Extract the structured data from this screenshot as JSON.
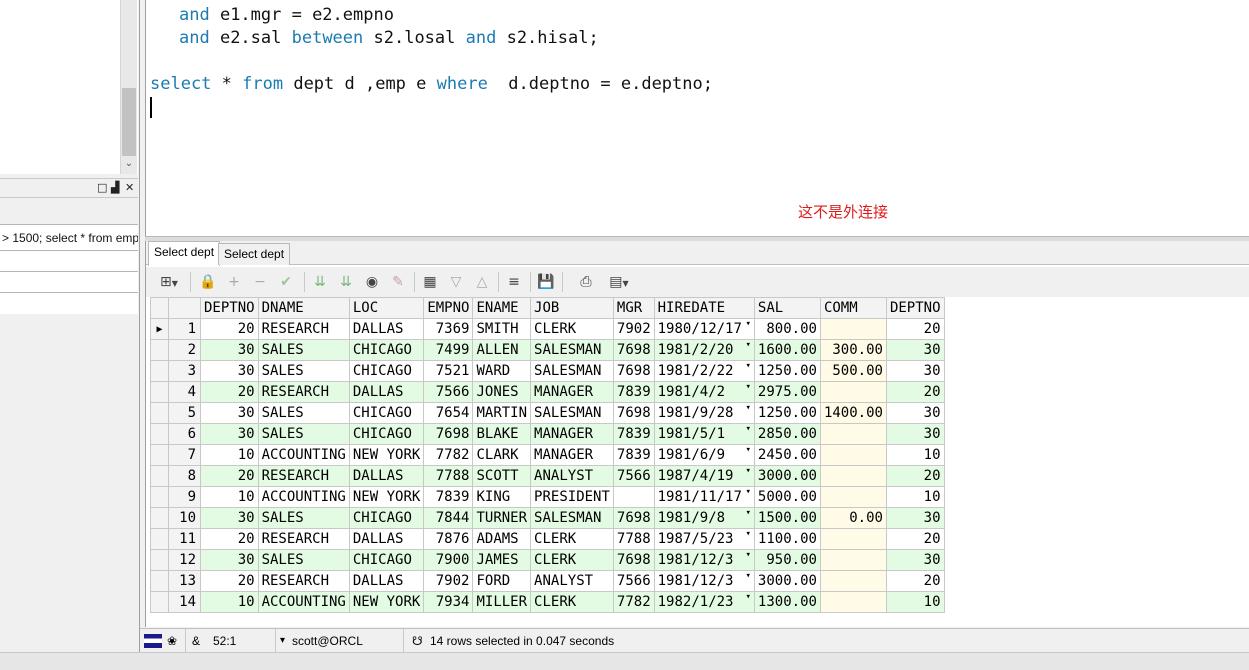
{
  "left_panel": {
    "history_item": "> 1500; select * from emp"
  },
  "editor": {
    "line1": {
      "kw": "and",
      "rest": " e1.mgr = e2.empno"
    },
    "line2": {
      "kw1": "and",
      "mid1": " e2.sal ",
      "kw2": "between",
      "mid2": " s2.losal ",
      "kw3": "and",
      "mid3": " s2.hisal;"
    },
    "line3": {
      "kw1": "select",
      "mid1": " * ",
      "kw2": "from",
      "mid2": " dept d ,emp e ",
      "kw3": "where",
      "mid3": "  d.deptno = e.deptno;"
    },
    "annotation": "这不是外连接"
  },
  "result_tabs": [
    "Select dept",
    "Select dept"
  ],
  "grid": {
    "columns": [
      "DEPTNO",
      "DNAME",
      "LOC",
      "EMPNO",
      "ENAME",
      "JOB",
      "MGR",
      "HIREDATE",
      "SAL",
      "COMM",
      "DEPTNO"
    ],
    "rows": [
      [
        "1",
        "20",
        "RESEARCH",
        "DALLAS",
        "7369",
        "SMITH",
        "CLERK",
        "7902",
        "1980/12/17",
        "800.00",
        "",
        "20"
      ],
      [
        "2",
        "30",
        "SALES",
        "CHICAGO",
        "7499",
        "ALLEN",
        "SALESMAN",
        "7698",
        "1981/2/20",
        "1600.00",
        "300.00",
        "30"
      ],
      [
        "3",
        "30",
        "SALES",
        "CHICAGO",
        "7521",
        "WARD",
        "SALESMAN",
        "7698",
        "1981/2/22",
        "1250.00",
        "500.00",
        "30"
      ],
      [
        "4",
        "20",
        "RESEARCH",
        "DALLAS",
        "7566",
        "JONES",
        "MANAGER",
        "7839",
        "1981/4/2",
        "2975.00",
        "",
        "20"
      ],
      [
        "5",
        "30",
        "SALES",
        "CHICAGO",
        "7654",
        "MARTIN",
        "SALESMAN",
        "7698",
        "1981/9/28",
        "1250.00",
        "1400.00",
        "30"
      ],
      [
        "6",
        "30",
        "SALES",
        "CHICAGO",
        "7698",
        "BLAKE",
        "MANAGER",
        "7839",
        "1981/5/1",
        "2850.00",
        "",
        "30"
      ],
      [
        "7",
        "10",
        "ACCOUNTING",
        "NEW YORK",
        "7782",
        "CLARK",
        "MANAGER",
        "7839",
        "1981/6/9",
        "2450.00",
        "",
        "10"
      ],
      [
        "8",
        "20",
        "RESEARCH",
        "DALLAS",
        "7788",
        "SCOTT",
        "ANALYST",
        "7566",
        "1987/4/19",
        "3000.00",
        "",
        "20"
      ],
      [
        "9",
        "10",
        "ACCOUNTING",
        "NEW YORK",
        "7839",
        "KING",
        "PRESIDENT",
        "",
        "1981/11/17",
        "5000.00",
        "",
        "10"
      ],
      [
        "10",
        "30",
        "SALES",
        "CHICAGO",
        "7844",
        "TURNER",
        "SALESMAN",
        "7698",
        "1981/9/8",
        "1500.00",
        "0.00",
        "30"
      ],
      [
        "11",
        "20",
        "RESEARCH",
        "DALLAS",
        "7876",
        "ADAMS",
        "CLERK",
        "7788",
        "1987/5/23",
        "1100.00",
        "",
        "20"
      ],
      [
        "12",
        "30",
        "SALES",
        "CHICAGO",
        "7900",
        "JAMES",
        "CLERK",
        "7698",
        "1981/12/3",
        "950.00",
        "",
        "30"
      ],
      [
        "13",
        "20",
        "RESEARCH",
        "DALLAS",
        "7902",
        "FORD",
        "ANALYST",
        "7566",
        "1981/12/3",
        "3000.00",
        "",
        "20"
      ],
      [
        "14",
        "10",
        "ACCOUNTING",
        "NEW YORK",
        "7934",
        "MILLER",
        "CLERK",
        "7782",
        "1982/1/23",
        "1300.00",
        "",
        "10"
      ]
    ]
  },
  "status": {
    "position": "52:1",
    "connection": "scott@ORCL",
    "message": "14 rows selected in 0.047 seconds"
  },
  "colors": {
    "keyword": "#1a7bb4",
    "annotation": "#e01a1a",
    "even_row": "#e3fbe3",
    "comm_cell": "#fffbe6"
  }
}
